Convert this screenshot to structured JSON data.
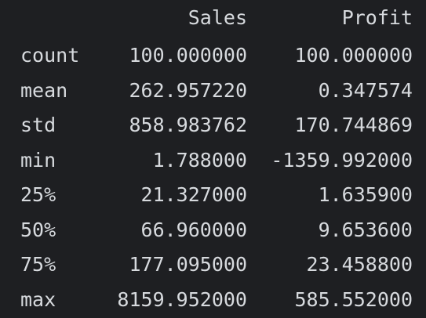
{
  "table": {
    "columns": [
      "Sales",
      "Profit"
    ],
    "rows": [
      {
        "label": "count",
        "sales": "100.000000",
        "profit": "100.000000"
      },
      {
        "label": "mean",
        "sales": "262.957220",
        "profit": "0.347574"
      },
      {
        "label": "std",
        "sales": "858.983762",
        "profit": "170.744869"
      },
      {
        "label": "min",
        "sales": "1.788000",
        "profit": "-1359.992000"
      },
      {
        "label": "25%",
        "sales": "21.327000",
        "profit": "1.635900"
      },
      {
        "label": "50%",
        "sales": "66.960000",
        "profit": "9.653600"
      },
      {
        "label": "75%",
        "sales": "177.095000",
        "profit": "23.458800"
      },
      {
        "label": "max",
        "sales": "8159.952000",
        "profit": "585.552000"
      }
    ]
  },
  "colors": {
    "background": "#1e1f22",
    "text": "#d7dade"
  }
}
